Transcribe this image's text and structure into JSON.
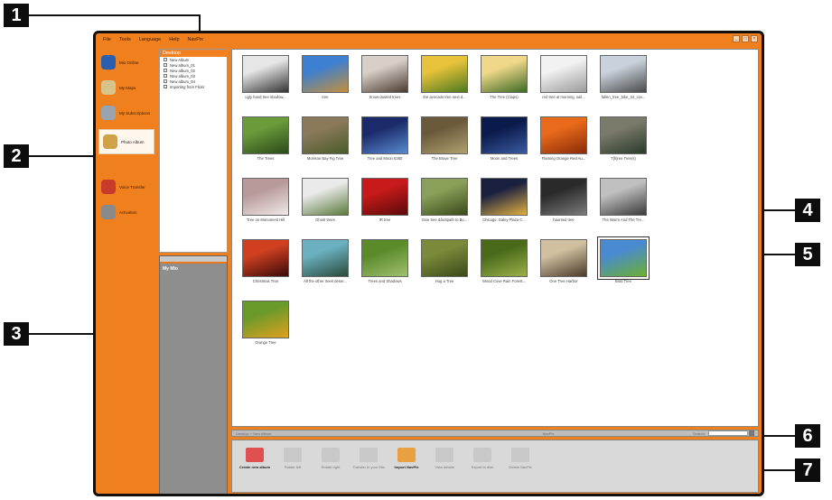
{
  "menu": [
    "File",
    "Tools",
    "Language",
    "Help",
    "NavPix"
  ],
  "window_buttons": [
    "_",
    "□",
    "×"
  ],
  "nav": [
    {
      "label": "Mio Online",
      "icon": "globe-icon",
      "color": "#2a5fb0"
    },
    {
      "label": "My Maps",
      "icon": "map-icon",
      "color": "#d8c48a"
    },
    {
      "label": "My Subscriptions",
      "icon": "subscriptions-icon",
      "color": "#9aa3b0"
    },
    {
      "label": "Photo Album",
      "icon": "photo-album-icon",
      "color": "#cfa24a"
    },
    {
      "label": "Voice Transfer",
      "icon": "voice-icon",
      "color": "#c83a2a"
    },
    {
      "label": "Activation",
      "icon": "activation-icon",
      "color": "#8a8a8a"
    }
  ],
  "tree": {
    "title": "Desktop",
    "items": [
      "New Album",
      "New album_01",
      "New album_02",
      "New album_03",
      "New album_04",
      "Importing from Flickr"
    ]
  },
  "mio": {
    "title": "My Mio"
  },
  "photos": [
    {
      "caption": "ugly hand tree shadow...",
      "c1": "#e6e6e6",
      "c2": "#333333"
    },
    {
      "caption": "tree",
      "c1": "#3d7fd0",
      "c2": "#c2903a"
    },
    {
      "caption": "Snow-dusted trees",
      "c1": "#d8d0c8",
      "c2": "#4a3a30"
    },
    {
      "caption": "the avocado tree next d...",
      "c1": "#e8c23a",
      "c2": "#4d7a1e"
    },
    {
      "caption": "The Tree (Claps)",
      "c1": "#f0d88a",
      "c2": "#3c6a24"
    },
    {
      "caption": "red tree at morning, sail...",
      "c1": "#f2f2f2",
      "c2": "#9a9a9a"
    },
    {
      "caption": "fallen_tree_bike_04_cov...",
      "c1": "#c9d2dc",
      "c2": "#4a4a4a"
    },
    {
      "caption": "The Trees",
      "c1": "#6a9a3a",
      "c2": "#2a4a1a"
    },
    {
      "caption": "Moreton Bay Fig Tree",
      "c1": "#8a7a5a",
      "c2": "#4a5a2a"
    },
    {
      "caption": "Tree and Moon 6360",
      "c1": "#1a2a6a",
      "c2": "#5a8ad0"
    },
    {
      "caption": "The Brave Tree",
      "c1": "#6a5a3a",
      "c2": "#b0a070"
    },
    {
      "caption": "Moon and Trees",
      "c1": "#0a1a4a",
      "c2": "#3a5aa0"
    },
    {
      "caption": "Flaming Orange Red Au...",
      "c1": "#e86a1a",
      "c2": "#8a2a0a"
    },
    {
      "caption": "T[h]ree Tree(s)",
      "c1": "#7a7a6a",
      "c2": "#2a3a2a"
    },
    {
      "caption": "Tree on Monument Hill",
      "c1": "#b89a9a",
      "c2": "#f0e8e8"
    },
    {
      "caption": "Ghost trees",
      "c1": "#eaeaea",
      "c2": "#5a7a3a"
    },
    {
      "caption": "IR tree",
      "c1": "#c81a1a",
      "c2": "#5a0a0a"
    },
    {
      "caption": "Give tree &footpath to Bo...",
      "c1": "#8aa05a",
      "c2": "#3a4a1a"
    },
    {
      "caption": "Chicago: Daley Plaza C...",
      "c1": "#1a2040",
      "c2": "#e0b040"
    },
    {
      "caption": "haunted tree",
      "c1": "#2a2a2a",
      "c2": "#7a7a7a"
    },
    {
      "caption": "The Worm And The Tre...",
      "c1": "#c0c0c0",
      "c2": "#3a3a3a"
    },
    {
      "caption": "Christmas Tree",
      "c1": "#d04020",
      "c2": "#3a0a0a"
    },
    {
      "caption": "All the other trees deser...",
      "c1": "#6ab0c0",
      "c2": "#2a4a3a"
    },
    {
      "caption": "Trees and Shadows",
      "c1": "#5a8a2a",
      "c2": "#a0c070"
    },
    {
      "caption": "Hug a Tree",
      "c1": "#7a8a3a",
      "c2": "#3a4a1a"
    },
    {
      "caption": "Wood Cove Rain Forest...",
      "c1": "#4a6a1a",
      "c2": "#9ab04a"
    },
    {
      "caption": "One Tree Harbor",
      "c1": "#d0c0a0",
      "c2": "#4a3a2a"
    },
    {
      "caption": "Bold Tree",
      "c1": "#4a8ad0",
      "c2": "#6ab030"
    },
    {
      "caption": "Orange Tree",
      "c1": "#6a9a2a",
      "c2": "#e0a020"
    }
  ],
  "status": {
    "path": "Desktop > New Album",
    "center": "NavPix",
    "search_label": "Search:",
    "search_value": ""
  },
  "toolbar": [
    {
      "label": "Create new album",
      "icon": "create-album-icon",
      "enabled": true,
      "color": "#e05050"
    },
    {
      "label": "Rotate left",
      "icon": "rotate-left-icon",
      "enabled": false,
      "color": "#c8c8c8"
    },
    {
      "label": "Rotate right",
      "icon": "rotate-right-icon",
      "enabled": false,
      "color": "#c8c8c8"
    },
    {
      "label": "Transfer to your Mio",
      "icon": "transfer-icon",
      "enabled": false,
      "color": "#c8c8c8"
    },
    {
      "label": "Import NavPix",
      "icon": "import-navpix-icon",
      "enabled": true,
      "color": "#e8a040"
    },
    {
      "label": "View details",
      "icon": "view-details-icon",
      "enabled": false,
      "color": "#c8c8c8"
    },
    {
      "label": "Export to disk",
      "icon": "export-disk-icon",
      "enabled": false,
      "color": "#c8c8c8"
    },
    {
      "label": "Delete NavPix",
      "icon": "delete-navpix-icon",
      "enabled": false,
      "color": "#c8c8c8"
    }
  ],
  "markers": [
    "1",
    "2",
    "3",
    "4",
    "5",
    "6",
    "7"
  ]
}
